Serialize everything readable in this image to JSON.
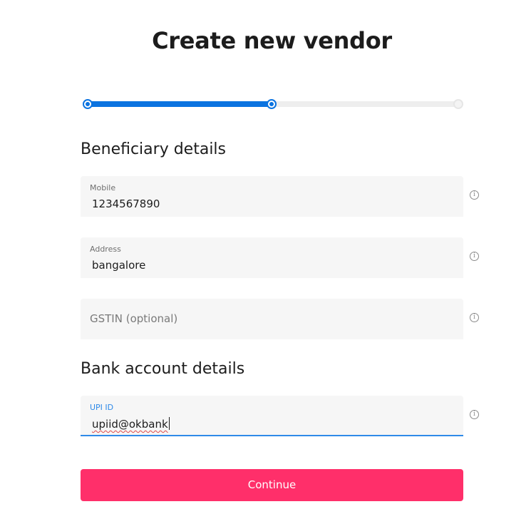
{
  "title": "Create new vendor",
  "stepper": {
    "steps_total": 3,
    "current_step": 2,
    "progress": 0.5
  },
  "beneficiary": {
    "heading": "Beneficiary details",
    "mobile": {
      "label": "Mobile",
      "value": "1234567890"
    },
    "address": {
      "label": "Address",
      "value": "bangalore"
    },
    "gstin": {
      "placeholder": "GSTIN (optional)"
    }
  },
  "bank": {
    "heading": "Bank account details",
    "upi": {
      "label": "UPI ID",
      "value": "upiid@okbank"
    }
  },
  "continue_label": "Continue",
  "icons": {
    "info": "info-icon"
  },
  "colors": {
    "accent": "#0b73e0",
    "focus": "#2f8ae8",
    "primary_button": "#ff2f6a",
    "field_bg": "#f6f6f6"
  }
}
